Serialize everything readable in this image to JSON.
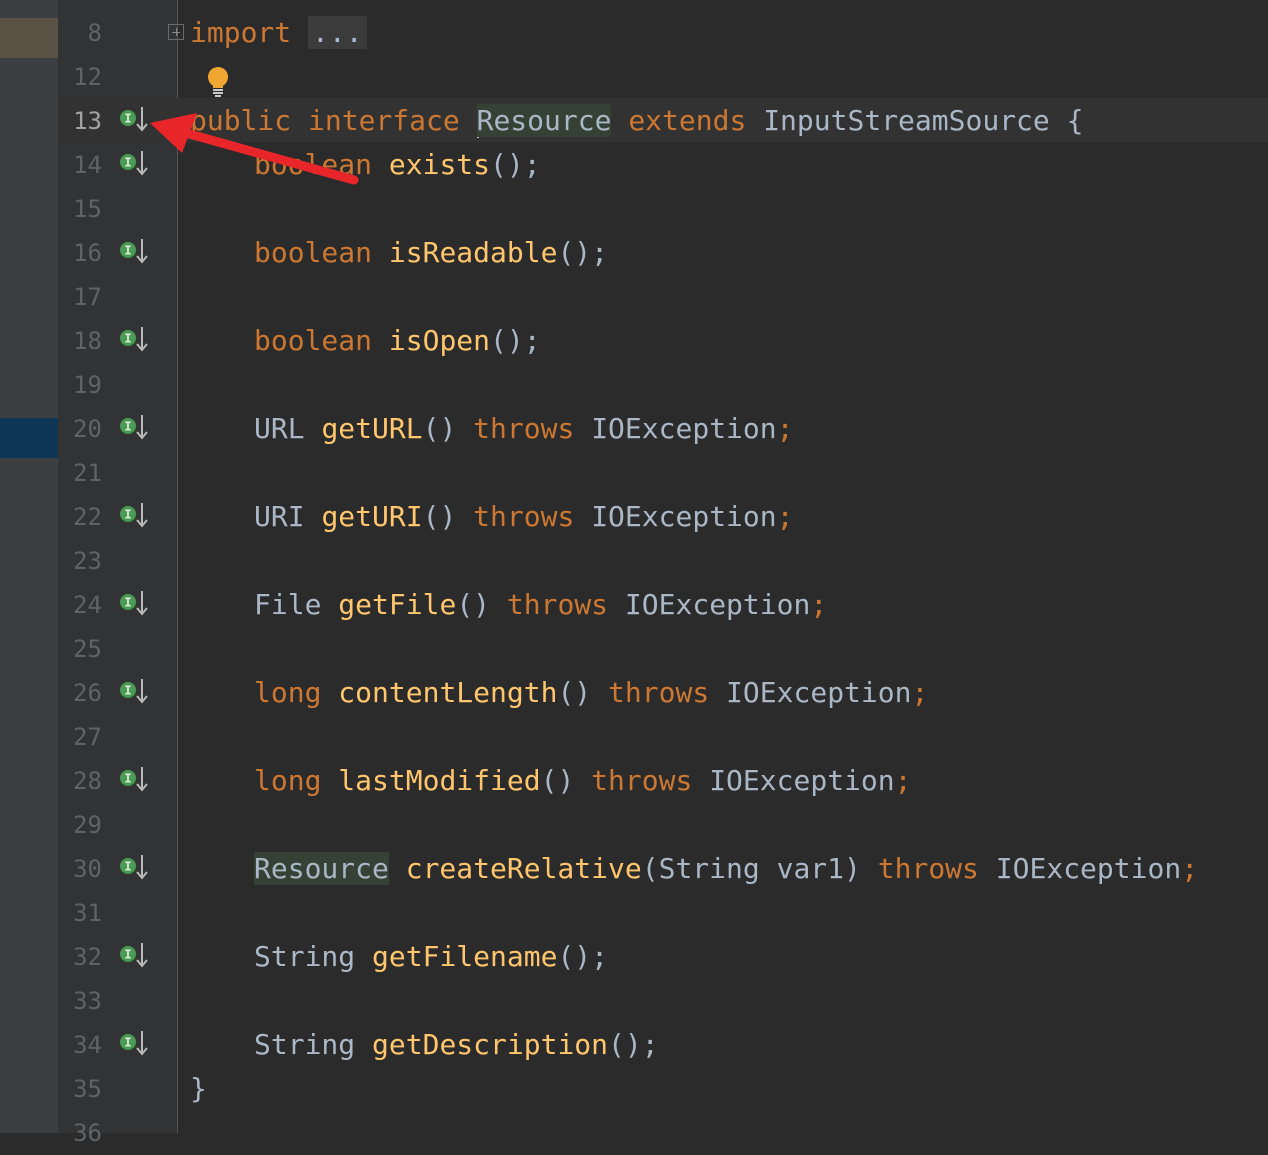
{
  "editor": {
    "lines": [
      {
        "no": "8"
      },
      {
        "no": "12"
      },
      {
        "no": "13"
      },
      {
        "no": "14"
      },
      {
        "no": "15"
      },
      {
        "no": "16"
      },
      {
        "no": "17"
      },
      {
        "no": "18"
      },
      {
        "no": "19"
      },
      {
        "no": "20"
      },
      {
        "no": "21"
      },
      {
        "no": "22"
      },
      {
        "no": "23"
      },
      {
        "no": "24"
      },
      {
        "no": "25"
      },
      {
        "no": "26"
      },
      {
        "no": "27"
      },
      {
        "no": "28"
      },
      {
        "no": "29"
      },
      {
        "no": "30"
      },
      {
        "no": "31"
      },
      {
        "no": "32"
      },
      {
        "no": "33"
      },
      {
        "no": "34"
      },
      {
        "no": "35"
      },
      {
        "no": "36"
      }
    ],
    "code": {
      "import_kw": "import",
      "import_folded": "...",
      "l13": {
        "public": "public",
        "interface": "interface",
        "name": "Resource",
        "extends": "extends",
        "super": "InputStreamSource",
        "brace": "{"
      },
      "l14": {
        "type": "boolean",
        "method": "exists",
        "rest": "();"
      },
      "l16": {
        "type": "boolean",
        "method": "isReadable",
        "rest": "();"
      },
      "l18": {
        "type": "boolean",
        "method": "isOpen",
        "rest": "();"
      },
      "l20": {
        "type": "URL",
        "method": "getURL",
        "paren": "()",
        "throws": "throws",
        "exc": "IOException",
        "semi": ";"
      },
      "l22": {
        "type": "URI",
        "method": "getURI",
        "paren": "()",
        "throws": "throws",
        "exc": "IOException",
        "semi": ";"
      },
      "l24": {
        "type": "File",
        "method": "getFile",
        "paren": "()",
        "throws": "throws",
        "exc": "IOException",
        "semi": ";"
      },
      "l26": {
        "type": "long",
        "method": "contentLength",
        "paren": "()",
        "throws": "throws",
        "exc": "IOException",
        "semi": ";"
      },
      "l28": {
        "type": "long",
        "method": "lastModified",
        "paren": "()",
        "throws": "throws",
        "exc": "IOException",
        "semi": ";"
      },
      "l30": {
        "type": "Resource",
        "method": "createRelative",
        "params": "(String var1)",
        "throws": "throws",
        "exc": "IOException",
        "semi": ";"
      },
      "l32": {
        "type": "String",
        "method": "getFilename",
        "rest": "();"
      },
      "l34": {
        "type": "String",
        "method": "getDescription",
        "rest": "();"
      },
      "l35": {
        "brace": "}"
      }
    },
    "icons": {
      "implemented": "implemented-method-icon",
      "bulb": "lightbulb-intention-icon",
      "fold": "fold-expand-icon"
    },
    "colors": {
      "keyword": "#cc7832",
      "method": "#ffc66d",
      "plain": "#a9b7c6",
      "background": "#2b2b2b",
      "annotation_arrow": "#e8262a"
    }
  }
}
